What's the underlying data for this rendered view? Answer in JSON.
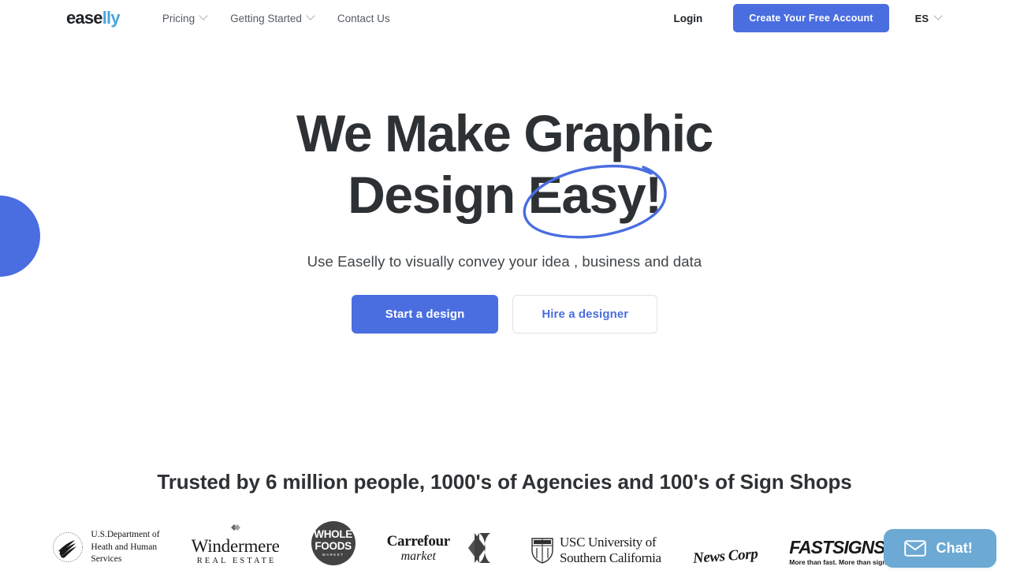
{
  "navbar": {
    "logo": {
      "part1": "ease",
      "part2": "lly",
      "accent_color": "#4aa3dd"
    },
    "links": [
      {
        "label": "Pricing",
        "has_dropdown": true,
        "icon": "chevron-down-icon"
      },
      {
        "label": "Getting Started",
        "has_dropdown": true,
        "icon": "chevron-down-icon"
      },
      {
        "label": "Contact Us",
        "has_dropdown": false
      }
    ],
    "login_label": "Login",
    "cta_label": "Create Your Free Account",
    "cta_color": "#4a6ee0",
    "language": {
      "label": "ES",
      "icon": "chevron-down-icon"
    }
  },
  "hero": {
    "headline_line1": "We Make Graphic",
    "headline_line2_prefix": "Design ",
    "headline_line2_highlight": "Easy!",
    "highlight_annotation": "hand-drawn-ellipse",
    "annotation_color": "#4a6ee0",
    "subtitle": "Use Easelly to visually convey your idea , business and data",
    "primary_button": "Start a design",
    "secondary_button": "Hire a designer"
  },
  "decor": {
    "circle_color": "#4a6ee0"
  },
  "trusted": {
    "title": "Trusted by 6 million people, 1000's of Agencies and 100's of Sign Shops",
    "logos": [
      {
        "name": "us-department-of-health-and-human-services",
        "line1": "U.S.Department of",
        "line2": "Heath and Human",
        "line3": "Services"
      },
      {
        "name": "windermere-real-estate",
        "line1": "Windermere",
        "line2": "REAL ESTATE"
      },
      {
        "name": "whole-foods-market",
        "line1": "WHOLE",
        "line2": "FOODS",
        "line3": "MARKET"
      },
      {
        "name": "carrefour-market",
        "line1": "Carrefour",
        "line2": "market"
      },
      {
        "name": "usc-university-of-southern-california",
        "line1": "USC University of",
        "line2": "Southern California"
      },
      {
        "name": "news-corp",
        "line1": "News Corp"
      },
      {
        "name": "fastsigns",
        "line1": "FASTSIGNS",
        "line2": "More than fast. More than signs."
      }
    ]
  },
  "chat": {
    "label": "Chat!",
    "icon": "envelope-icon",
    "color": "#6ca9d4"
  }
}
